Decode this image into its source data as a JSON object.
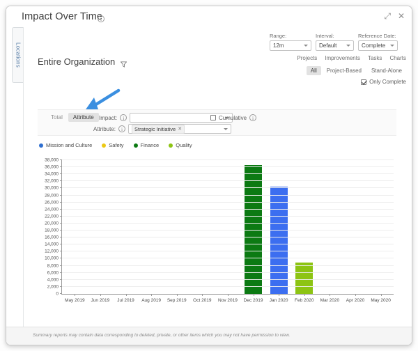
{
  "window": {
    "title": "Impact Over Time",
    "info_icon": "i",
    "expand_label": "⤢",
    "close_label": "✕"
  },
  "side_tab": {
    "label": "Locations"
  },
  "controls": {
    "range": {
      "label": "Range:",
      "value": "12m"
    },
    "interval": {
      "label": "Interval:",
      "value": "Default"
    },
    "reference_date": {
      "label": "Reference Date:",
      "value": "Complete"
    },
    "tabs": [
      "Projects",
      "Improvements",
      "Tasks",
      "Charts"
    ],
    "segments": [
      {
        "label": "All",
        "active": true
      },
      {
        "label": "Project-Based",
        "active": false
      },
      {
        "label": "Stand-Alone",
        "active": false
      }
    ],
    "only_complete": {
      "label": "Only Complete",
      "checked": true
    }
  },
  "organization": {
    "title": "Entire Organization",
    "filter_icon": "funnel-icon"
  },
  "filters": {
    "mode_toggle": [
      {
        "label": "Total",
        "active": false
      },
      {
        "label": "Attribute",
        "active": true
      }
    ],
    "impact": {
      "label": "Impact:",
      "value": "",
      "placeholder": ""
    },
    "attribute": {
      "label": "Attribute:",
      "chip": "Strategic Initiative",
      "chip_remove": "✕"
    },
    "cumulative": {
      "label": "Cumulative",
      "checked": false
    }
  },
  "legend": [
    {
      "label": "Mission and Culture",
      "color": "#2f6fd0"
    },
    {
      "label": "Safety",
      "color": "#ecc915"
    },
    {
      "label": "Finance",
      "color": "#0c7a13"
    },
    {
      "label": "Quality",
      "color": "#8dc413"
    }
  ],
  "chart_data": {
    "type": "bar",
    "title": "Impact Over Time",
    "xlabel": "",
    "ylabel": "",
    "ylim": [
      0,
      38000
    ],
    "ytick_step": 2000,
    "yticks": [
      0,
      2000,
      4000,
      6000,
      8000,
      10000,
      12000,
      14000,
      16000,
      18000,
      20000,
      22000,
      24000,
      26000,
      28000,
      30000,
      32000,
      34000,
      36000,
      38000
    ],
    "ytick_labels": [
      "0",
      "2,000",
      "4,000",
      "6,000",
      "8,000",
      "10,000",
      "12,000",
      "14,000",
      "16,000",
      "18,000",
      "20,000",
      "22,000",
      "24,000",
      "26,000",
      "28,000",
      "30,000",
      "32,000",
      "34,000",
      "36,000",
      "38,000"
    ],
    "grid": true,
    "legend_position": "top-left",
    "categories": [
      "May 2019",
      "Jun 2019",
      "Jul 2019",
      "Aug 2019",
      "Sep 2019",
      "Oct 2019",
      "Nov 2019",
      "Dec 2019",
      "Jan 2020",
      "Feb 2020",
      "Mar 2020",
      "Apr 2020",
      "May 2020"
    ],
    "values": [
      0,
      0,
      0,
      0,
      0,
      0,
      0,
      36700,
      30400,
      9000,
      0,
      0,
      0
    ],
    "bar_colors": [
      "",
      "",
      "",
      "",
      "",
      "",
      "",
      "#0c7a13",
      "#3c6ef0",
      "#8dc413",
      "",
      "",
      ""
    ],
    "series": [
      {
        "name": "Finance",
        "color": "#0c7a13",
        "values": [
          0,
          0,
          0,
          0,
          0,
          0,
          0,
          36700,
          0,
          0,
          0,
          0,
          0
        ]
      },
      {
        "name": "Mission and Culture",
        "color": "#3c6ef0",
        "values": [
          0,
          0,
          0,
          0,
          0,
          0,
          0,
          0,
          30400,
          0,
          0,
          0,
          0
        ]
      },
      {
        "name": "Quality",
        "color": "#8dc413",
        "values": [
          0,
          0,
          0,
          0,
          0,
          0,
          0,
          0,
          0,
          9000,
          0,
          0,
          0
        ]
      }
    ]
  },
  "footer": {
    "text": "Summary reports may contain data corresponding to deleted, private, or other items which you may not have permission to view."
  }
}
